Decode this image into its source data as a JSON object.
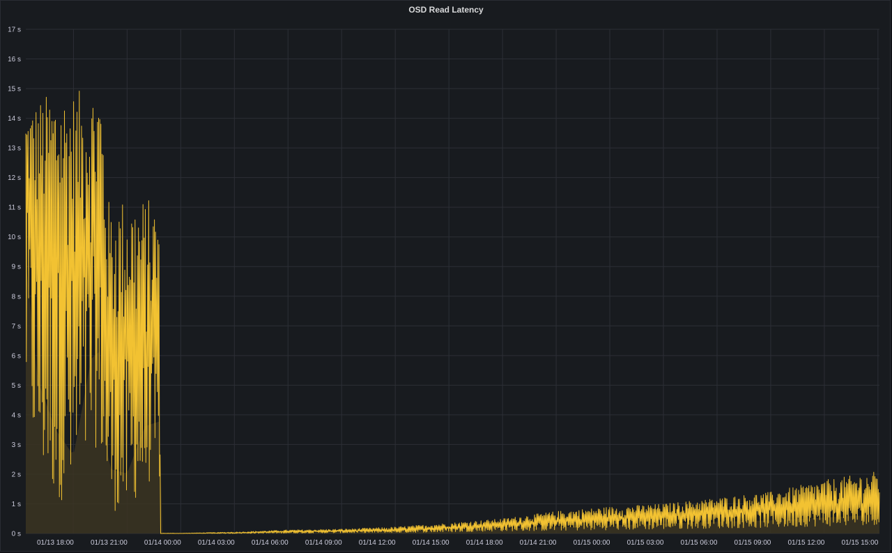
{
  "panel": {
    "title": "OSD Read Latency"
  },
  "chart_data": {
    "type": "area",
    "title": "OSD Read Latency",
    "xlabel": "",
    "ylabel": "",
    "y_unit": "s",
    "ylim": [
      0,
      17
    ],
    "y_ticks": [
      "0 s",
      "1 s",
      "2 s",
      "3 s",
      "4 s",
      "5 s",
      "6 s",
      "7 s",
      "8 s",
      "9 s",
      "10 s",
      "11 s",
      "12 s",
      "13 s",
      "14 s",
      "15 s",
      "16 s",
      "17 s"
    ],
    "x_range": [
      "01/13 15:20",
      "01/15 15:05"
    ],
    "x_ticks": [
      "01/13 18:00",
      "01/13 21:00",
      "01/14 00:00",
      "01/14 03:00",
      "01/14 06:00",
      "01/14 09:00",
      "01/14 12:00",
      "01/14 15:00",
      "01/14 18:00",
      "01/14 21:00",
      "01/15 00:00",
      "01/15 03:00",
      "01/15 06:00",
      "01/15 09:00",
      "01/15 12:00",
      "01/15 15:00"
    ],
    "grid": true,
    "legend": "none",
    "colors": {
      "series_line": "#f2c232",
      "series_fill": "#3b3422",
      "grid": "#2c2f36",
      "background": "#181b1f"
    },
    "series": [
      {
        "x": [
          "01/13 15:20",
          "01/13 16:00",
          "01/13 17:00",
          "01/13 18:00",
          "01/13 19:00",
          "01/13 19:30",
          "01/13 20:00",
          "01/13 21:00",
          "01/13 22:00",
          "01/13 22:50",
          "01/13 22:51",
          "01/14 00:00",
          "01/14 03:00",
          "01/14 06:00",
          "01/14 09:00",
          "01/14 12:00",
          "01/14 15:00",
          "01/14 18:00",
          "01/14 21:00",
          "01/15 00:00",
          "01/15 03:00",
          "01/15 06:00",
          "01/15 09:00",
          "01/15 12:00",
          "01/15 15:00"
        ],
        "max": [
          14.2,
          14.6,
          15.0,
          14.9,
          15.0,
          15.4,
          11.1,
          11.4,
          11.3,
          11.3,
          0.01,
          0.01,
          0.05,
          0.12,
          0.15,
          0.22,
          0.35,
          0.5,
          0.75,
          0.9,
          1.0,
          1.2,
          1.4,
          1.8,
          2.1
        ],
        "min": [
          4.7,
          2.3,
          1.3,
          0.8,
          2.8,
          3.0,
          0.8,
          0.7,
          1.7,
          1.8,
          0.0,
          0.0,
          0.0,
          0.01,
          0.02,
          0.03,
          0.05,
          0.08,
          0.1,
          0.12,
          0.15,
          0.18,
          0.2,
          0.25,
          0.3
        ],
        "typical": [
          11.0,
          10.0,
          9.5,
          9.0,
          9.5,
          9.0,
          6.0,
          6.0,
          6.0,
          6.0,
          0.0,
          0.0,
          0.02,
          0.06,
          0.08,
          0.1,
          0.2,
          0.3,
          0.4,
          0.5,
          0.6,
          0.7,
          0.8,
          0.9,
          1.0
        ]
      }
    ]
  }
}
